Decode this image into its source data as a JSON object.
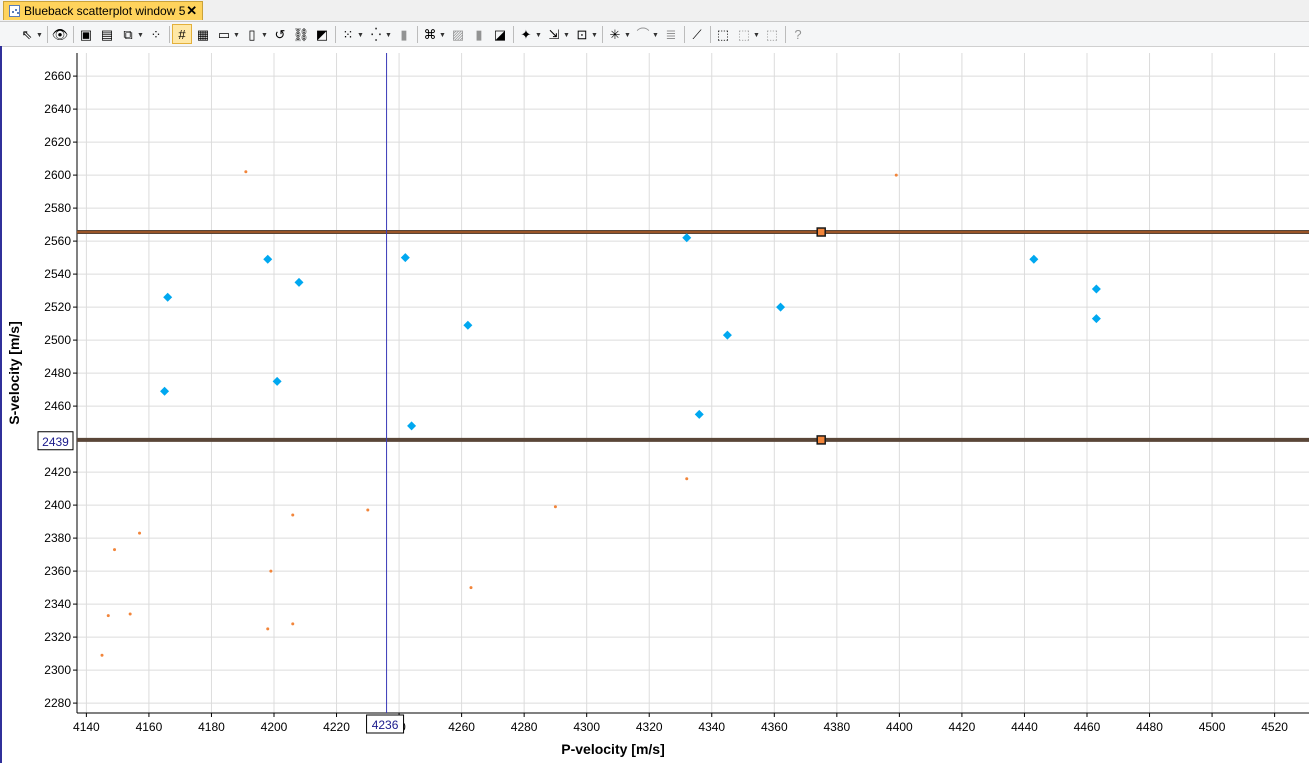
{
  "window": {
    "tab_title": "Blueback scatterplot window 5",
    "close_glyph": "✕"
  },
  "toolbar": {
    "items": [
      {
        "name": "select-pointer-icon",
        "glyph": "⇖",
        "dropdown": true
      },
      {
        "name": "eye-view-icon",
        "glyph": "👁"
      },
      {
        "name": "window-layout-icon",
        "glyph": "▣"
      },
      {
        "name": "window-list-icon",
        "glyph": "▤"
      },
      {
        "name": "copy-window-icon",
        "glyph": "⧉",
        "dropdown": true
      },
      {
        "name": "scatter-settings-icon",
        "glyph": "⁘"
      },
      {
        "name": "grid-toggle-icon",
        "glyph": "#",
        "selected": true
      },
      {
        "name": "table-icon",
        "glyph": "▦"
      },
      {
        "name": "frame-bottom-icon",
        "glyph": "▭",
        "dropdown": true
      },
      {
        "name": "frame-left-icon",
        "glyph": "▯",
        "dropdown": true
      },
      {
        "name": "rotate-icon",
        "glyph": "↺"
      },
      {
        "name": "link-icon",
        "glyph": "⛓"
      },
      {
        "name": "fill-icon",
        "glyph": "◩"
      },
      {
        "name": "points-icon",
        "glyph": "⁙",
        "dropdown": true
      },
      {
        "name": "points-select-icon",
        "glyph": "⁛",
        "dropdown": true
      },
      {
        "name": "cylinder-icon",
        "glyph": "▮",
        "disabled": true
      },
      {
        "name": "pattern-icon",
        "glyph": "⌘",
        "dropdown": true
      },
      {
        "name": "filter-icon",
        "glyph": "▨",
        "disabled": true
      },
      {
        "name": "cylinder-alt-icon",
        "glyph": "▮",
        "disabled": true
      },
      {
        "name": "paint-icon",
        "glyph": "◪"
      },
      {
        "name": "star-add-icon",
        "glyph": "✦",
        "dropdown": true
      },
      {
        "name": "export-icon",
        "glyph": "⇲",
        "dropdown": true
      },
      {
        "name": "save-view-icon",
        "glyph": "⊡",
        "dropdown": true
      },
      {
        "name": "spark-icon",
        "glyph": "✳",
        "dropdown": true
      },
      {
        "name": "curve-icon",
        "glyph": "⌒",
        "dropdown": true,
        "disabled": true
      },
      {
        "name": "list-alt-icon",
        "glyph": "≣",
        "disabled": true
      },
      {
        "name": "regression-line-icon",
        "glyph": "⟋"
      },
      {
        "name": "polygon-add-icon",
        "glyph": "⬚"
      },
      {
        "name": "polygon-edit-icon",
        "glyph": "⬚",
        "dropdown": true,
        "disabled": true
      },
      {
        "name": "polygon-delete-icon",
        "glyph": "⬚",
        "disabled": true
      },
      {
        "name": "help-icon",
        "glyph": "?",
        "disabled": true
      }
    ]
  },
  "colors": {
    "grid": "#dcdcdc",
    "axis": "#000000",
    "blue_point": "#00a8f0",
    "orange_point": "#f2853a",
    "crosshair": "#3a3ab8",
    "band_line_top": "#b05a22",
    "band_line": "#5a4638",
    "handle_fill": "#f2853a"
  },
  "chart_data": {
    "type": "scatter",
    "xlabel": "P-velocity [m/s]",
    "ylabel": "S-velocity [m/s]",
    "xlim": [
      4137,
      4531
    ],
    "ylim": [
      2274,
      2674
    ],
    "xticks": [
      4140,
      4160,
      4180,
      4200,
      4220,
      4240,
      4260,
      4280,
      4300,
      4320,
      4340,
      4360,
      4380,
      4400,
      4420,
      4440,
      4460,
      4480,
      4500,
      4520
    ],
    "xticklabels": [
      "4140",
      "4160",
      "4180",
      "4200",
      "4220",
      "40",
      "4260",
      "4280",
      "4300",
      "4320",
      "4340",
      "4360",
      "4380",
      "4400",
      "4420",
      "4440",
      "4460",
      "4480",
      "4500",
      "4520"
    ],
    "yticks": [
      2280,
      2300,
      2320,
      2340,
      2360,
      2380,
      2400,
      2420,
      2460,
      2480,
      2500,
      2520,
      2540,
      2560,
      2580,
      2600,
      2620,
      2640,
      2660
    ],
    "grid": true,
    "series": [
      {
        "marker": "diamond",
        "color": "#00a8f0",
        "points": [
          [
            4166,
            2526
          ],
          [
            4165,
            2469
          ],
          [
            4198,
            2549
          ],
          [
            4208,
            2535
          ],
          [
            4201,
            2475
          ],
          [
            4242,
            2550
          ],
          [
            4244,
            2448
          ],
          [
            4262,
            2509
          ],
          [
            4332,
            2562
          ],
          [
            4336,
            2455
          ],
          [
            4345,
            2503
          ],
          [
            4362,
            2520
          ],
          [
            4443,
            2549
          ],
          [
            4463,
            2531
          ],
          [
            4463,
            2513
          ]
        ]
      },
      {
        "marker": "dot",
        "color": "#f2853a",
        "points": [
          [
            4191,
            2602
          ],
          [
            4399,
            2600
          ],
          [
            4332,
            2416
          ],
          [
            4290,
            2399
          ],
          [
            4230,
            2397
          ],
          [
            4206,
            2394
          ],
          [
            4157,
            2383
          ],
          [
            4149,
            2373
          ],
          [
            4199,
            2360
          ],
          [
            4263,
            2350
          ],
          [
            4154,
            2334
          ],
          [
            4147,
            2333
          ],
          [
            4206,
            2328
          ],
          [
            4198,
            2325
          ],
          [
            4145,
            2309
          ]
        ]
      }
    ],
    "horizontal_lines": [
      {
        "y": 2565.5,
        "handle_x": 4375
      },
      {
        "y": 2439.5,
        "handle_x": 4375
      }
    ],
    "crosshair": {
      "x": 4236,
      "y": 2439,
      "x_label": "4236",
      "y_label": "2439"
    }
  }
}
